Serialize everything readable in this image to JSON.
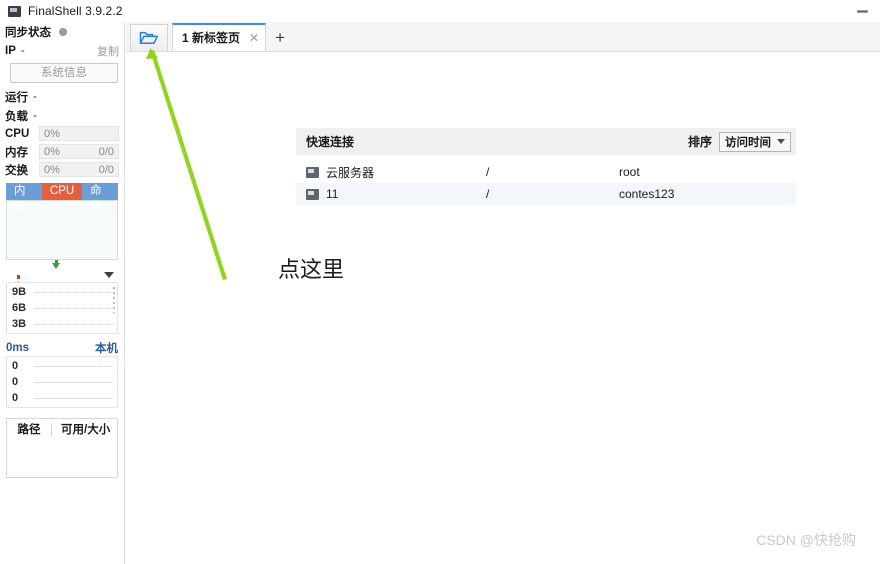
{
  "window": {
    "title": "FinalShell 3.9.2.2",
    "icon": "monitor-icon",
    "minimize_label": "–"
  },
  "sidebar": {
    "sync": {
      "label": "同步状态",
      "indicator": "status-dot"
    },
    "ip": {
      "label": "IP",
      "value": "-",
      "copy_label": "复制"
    },
    "sysinfo_button": "系统信息",
    "runtime": {
      "label": "运行",
      "value": "-"
    },
    "load": {
      "label": "负载",
      "value": "-"
    },
    "meters": [
      {
        "name": "CPU",
        "percent": "0%",
        "detail": ""
      },
      {
        "name": "内存",
        "percent": "0%",
        "detail": "0/0"
      },
      {
        "name": "交换",
        "percent": "0%",
        "detail": "0/0"
      }
    ],
    "proc_tabs": [
      {
        "label": "内存",
        "active": false
      },
      {
        "label": "CPU",
        "active": true
      },
      {
        "label": "命令",
        "active": false
      }
    ],
    "network": {
      "upload_icon": "arrow-up-icon",
      "download_icon": "arrow-down-icon",
      "menu_icon": "caret-down-icon",
      "y_labels": [
        "9B",
        "6B",
        "3B"
      ]
    },
    "ping": {
      "latency": "0ms",
      "host": "本机",
      "y_labels": [
        "0",
        "0",
        "0"
      ]
    },
    "disk": {
      "col_path": "路径",
      "col_free": "可用/大小"
    }
  },
  "tabbar": {
    "folder_icon": "open-folder-icon",
    "tabs": [
      {
        "label": "1 新标签页",
        "close_icon": "close-icon"
      }
    ],
    "add_tab_icon": "plus-icon"
  },
  "quick_connect": {
    "title": "快速连接",
    "sort_label": "排序",
    "sort_value": "访问时间",
    "sort_caret": "caret-down-icon",
    "rows": [
      {
        "icon": "terminal-icon",
        "name": "云服务器",
        "path": "/",
        "user": "root"
      },
      {
        "icon": "terminal-icon",
        "name": "11",
        "path": "/",
        "user": "contes123"
      }
    ]
  },
  "annotations": {
    "callout_text": "点这里",
    "arrow_color": "#8FD31B",
    "arrow_icon": "arrow-pointer-icon"
  },
  "watermark": "CSDN @快抢购",
  "colors": {
    "accent_blue": "#3a8ee6",
    "tab_blue": "#6b9ed4",
    "tab_hot": "#e2603f",
    "link_blue": "#2a5d9e",
    "annotation_green": "#8FD31B"
  }
}
